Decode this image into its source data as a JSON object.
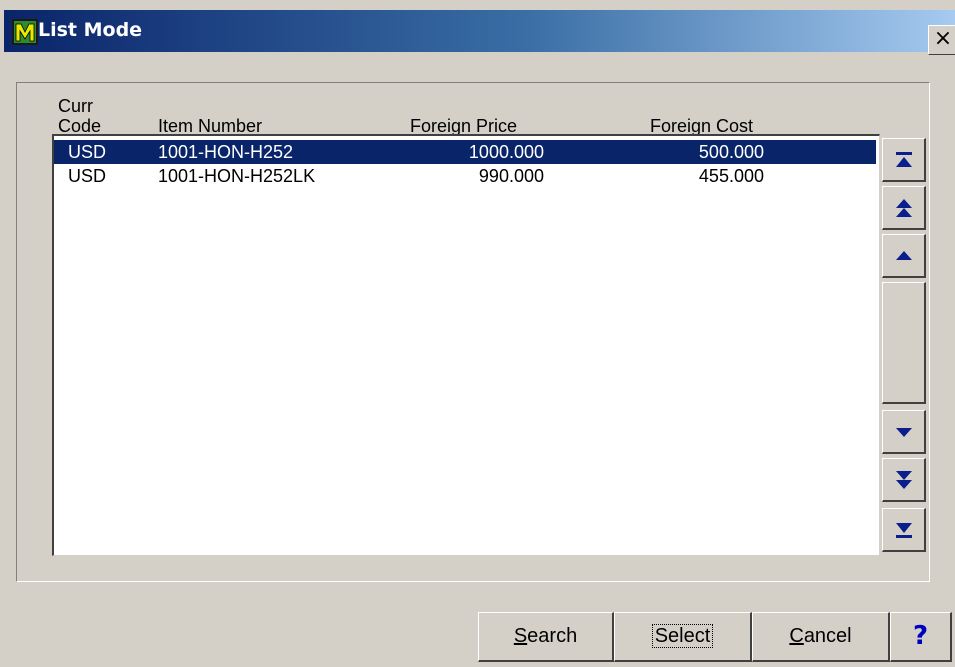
{
  "window": {
    "title": "List Mode",
    "close_glyph": "×"
  },
  "icons": {
    "app": "app-m-icon",
    "close": "close-icon"
  },
  "columns": {
    "curr_code_line1": "Curr",
    "curr_code_line2": "Code",
    "item_number": "Item Number",
    "foreign_price": "Foreign Price",
    "foreign_cost": "Foreign Cost"
  },
  "rows": [
    {
      "curr": "USD",
      "item": "1001-HON-H252",
      "price": "1000.000",
      "cost": "500.000",
      "selected": true
    },
    {
      "curr": "USD",
      "item": "1001-HON-H252LK",
      "price": "990.000",
      "cost": "455.000",
      "selected": false
    }
  ],
  "scroll_buttons": [
    "first-record-icon",
    "page-up-icon",
    "line-up-icon",
    "line-down-icon",
    "page-down-icon",
    "last-record-icon"
  ],
  "buttons": {
    "search_mnemonic": "S",
    "search_rest": "earch",
    "select": "Select",
    "cancel_mnemonic": "C",
    "cancel_rest": "ancel",
    "help": "?"
  },
  "colors": {
    "selection": "#0a246a",
    "arrow": "#0a1e8c",
    "help": "#0000c0"
  }
}
